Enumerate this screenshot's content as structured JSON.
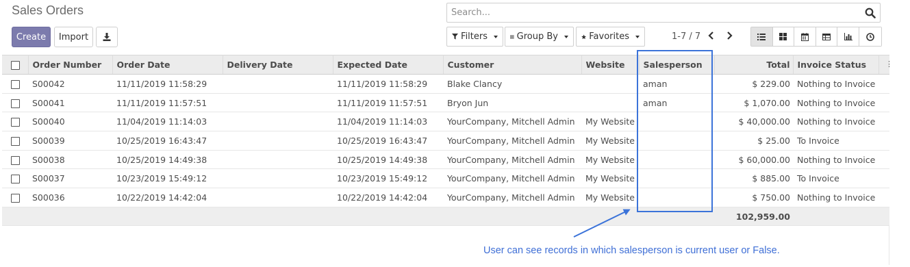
{
  "page_title": "Sales Orders",
  "buttons": {
    "create": "Create",
    "import": "Import",
    "download_icon": "download-icon"
  },
  "search": {
    "placeholder": "Search...",
    "icon": "search-icon"
  },
  "filters": {
    "filters": "Filters",
    "group_by": "Group By",
    "favorites": "Favorites"
  },
  "pager": {
    "text": "1-7 / 7"
  },
  "views": [
    "list-view-icon",
    "kanban-view-icon",
    "calendar-view-icon",
    "pivot-view-icon",
    "graph-view-icon",
    "activity-view-icon"
  ],
  "colors": {
    "create": "#7c7bad",
    "annotation": "#3b73d9"
  },
  "table": {
    "headers": {
      "order_number": "Order Number",
      "order_date": "Order Date",
      "delivery_date": "Delivery Date",
      "expected_date": "Expected Date",
      "customer": "Customer",
      "website": "Website",
      "salesperson": "Salesperson",
      "total": "Total",
      "invoice_status": "Invoice Status"
    },
    "rows": [
      {
        "order_number": "S00042",
        "order_date": "11/11/2019 11:58:29",
        "delivery_date": "",
        "expected_date": "11/11/2019 11:58:29",
        "customer": "Blake Clancy",
        "website": "",
        "salesperson": "aman",
        "total": "$ 229.00",
        "invoice_status": "Nothing to Invoice"
      },
      {
        "order_number": "S00041",
        "order_date": "11/11/2019 11:57:51",
        "delivery_date": "",
        "expected_date": "11/11/2019 11:57:51",
        "customer": "Bryon Jun",
        "website": "",
        "salesperson": "aman",
        "total": "$ 1,070.00",
        "invoice_status": "Nothing to Invoice"
      },
      {
        "order_number": "S00040",
        "order_date": "11/04/2019 11:14:03",
        "delivery_date": "",
        "expected_date": "11/04/2019 11:14:03",
        "customer": "YourCompany, Mitchell Admin",
        "website": "My Website",
        "salesperson": "",
        "total": "$ 40,000.00",
        "invoice_status": "Nothing to Invoice"
      },
      {
        "order_number": "S00039",
        "order_date": "10/25/2019 16:43:47",
        "delivery_date": "",
        "expected_date": "10/25/2019 16:43:47",
        "customer": "YourCompany, Mitchell Admin",
        "website": "My Website",
        "salesperson": "",
        "total": "$ 25.00",
        "invoice_status": "To Invoice"
      },
      {
        "order_number": "S00038",
        "order_date": "10/25/2019 14:49:38",
        "delivery_date": "",
        "expected_date": "10/25/2019 14:49:38",
        "customer": "YourCompany, Mitchell Admin",
        "website": "My Website",
        "salesperson": "",
        "total": "$ 60,000.00",
        "invoice_status": "Nothing to Invoice"
      },
      {
        "order_number": "S00037",
        "order_date": "10/23/2019 15:49:12",
        "delivery_date": "",
        "expected_date": "10/23/2019 15:49:12",
        "customer": "YourCompany, Mitchell Admin",
        "website": "My Website",
        "salesperson": "",
        "total": "$ 885.00",
        "invoice_status": "To Invoice"
      },
      {
        "order_number": "S00036",
        "order_date": "10/22/2019 14:42:04",
        "delivery_date": "",
        "expected_date": "10/22/2019 14:42:04",
        "customer": "YourCompany, Mitchell Admin",
        "website": "My Website",
        "salesperson": "",
        "total": "$ 750.00",
        "invoice_status": "Nothing to Invoice"
      }
    ],
    "footer_total": "102,959.00"
  },
  "annotation": {
    "text": "User can see records in which salesperson is current user or False."
  }
}
